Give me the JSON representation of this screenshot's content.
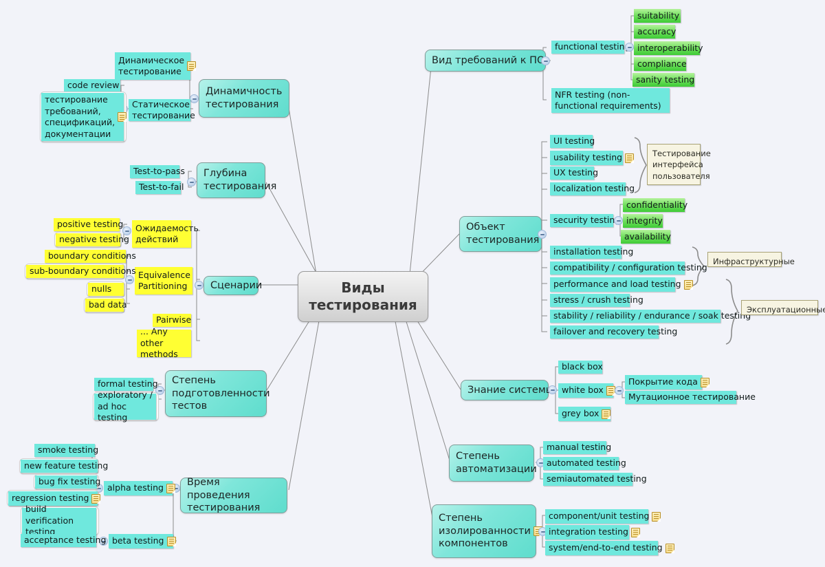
{
  "title": "Виды тестирования",
  "colors": {
    "background": "#f2f3f9",
    "central_fill": "#e4e4e4",
    "branch_teal": "#5fddcd",
    "leaf_teal": "#6fe8dd",
    "leaf_yellow": "#ffff33",
    "leaf_green": "#3fcb36",
    "callout_fill": "#f7f4e2",
    "callout_border": "#a8a275",
    "connector": "#8b8b8b"
  },
  "central": {
    "line1": "Виды",
    "line2": "тестирования"
  },
  "branches": {
    "dynamicity": {
      "label": "Динамичность тестирования"
    },
    "depth": {
      "label": "Глубина тестирования"
    },
    "scenarios": {
      "label": "Сценарии"
    },
    "readiness": {
      "label": "Степень подготовленности тестов"
    },
    "timing": {
      "label": "Время проведения тестирования"
    },
    "requirements": {
      "label": "Вид требований к ПО"
    },
    "object": {
      "label": "Объект тестирования"
    },
    "knowledge": {
      "label": "Знание системы"
    },
    "automation": {
      "label": "Степень автоматизации"
    },
    "isolation": {
      "label": "Степень изолированности компонентов"
    }
  },
  "dynamicity_children": [
    {
      "label": "Динамическое тестирование",
      "note": true
    },
    {
      "label": "Статическое тестирование",
      "note": false
    }
  ],
  "static_children": [
    {
      "label": "code review",
      "note": false
    },
    {
      "label": "тестирование требований, спецификаций, документации",
      "note": true
    }
  ],
  "depth_children": [
    {
      "label": "Test-to-pass"
    },
    {
      "label": "Test-to-fail"
    }
  ],
  "scenarios_children": [
    {
      "label": "Ожидаемость действий"
    },
    {
      "label": "Equivalence Partitioning"
    },
    {
      "label": "Pairwise"
    },
    {
      "label": "... Any other methods"
    }
  ],
  "expectation_children": [
    {
      "label": "positive testing"
    },
    {
      "label": "negative testing"
    }
  ],
  "equivalence_children": [
    {
      "label": "boundary conditions"
    },
    {
      "label": "sub-boundary conditions"
    },
    {
      "label": "nulls"
    },
    {
      "label": "bad data"
    }
  ],
  "readiness_children": [
    {
      "label": "formal testing"
    },
    {
      "label": "exploratory / ad hoc testing"
    }
  ],
  "timing_children": [
    {
      "label": "alpha testing",
      "note": true
    },
    {
      "label": "beta testing",
      "note": true
    }
  ],
  "alpha_children": [
    {
      "label": "smoke testing",
      "note": false
    },
    {
      "label": "new feature testing",
      "note": false
    },
    {
      "label": "bug fix testing",
      "note": false
    },
    {
      "label": "regression testing",
      "note": true
    },
    {
      "label": "build verification testing",
      "note": false
    }
  ],
  "beta_children": [
    {
      "label": "acceptance testing",
      "note": false
    }
  ],
  "requirements_children": [
    {
      "label": "functional testing",
      "note": false
    },
    {
      "label": "NFR testing (non-functional requirements)",
      "note": false
    }
  ],
  "functional_children": [
    {
      "label": "suitability"
    },
    {
      "label": "accuracy"
    },
    {
      "label": "interoperability"
    },
    {
      "label": "compliance"
    },
    {
      "label": "sanity testing"
    }
  ],
  "object_children": [
    {
      "label": "UI testing",
      "note": false
    },
    {
      "label": "usability testing",
      "note": true
    },
    {
      "label": "UX testing",
      "note": false
    },
    {
      "label": "localization testing",
      "note": false
    },
    {
      "label": "security testing",
      "note": false
    },
    {
      "label": "installation testing",
      "note": false
    },
    {
      "label": "compatibility / configuration testing",
      "note": false
    },
    {
      "label": "performance and load testing",
      "note": true
    },
    {
      "label": "stress / crush testing",
      "note": false
    },
    {
      "label": "stability / reliability / endurance / soak testing",
      "note": false
    },
    {
      "label": "failover and recovery testing",
      "note": false
    }
  ],
  "security_children": [
    {
      "label": "confidentiality"
    },
    {
      "label": "integrity"
    },
    {
      "label": "availability"
    }
  ],
  "callouts": {
    "ui": "Тестирование интерфейса пользователя",
    "infra": "Инфраструктурные",
    "operational": "Эксплуатационные"
  },
  "knowledge_children": [
    {
      "label": "black box",
      "note": false
    },
    {
      "label": "white box",
      "note": true
    },
    {
      "label": "grey box",
      "note": true
    }
  ],
  "whitebox_children": [
    {
      "label": "Покрытие кода",
      "note": true
    },
    {
      "label": "Мутационное тестирование",
      "note": false
    }
  ],
  "automation_children": [
    {
      "label": "manual testing"
    },
    {
      "label": "automated testing"
    },
    {
      "label": "semiautomated testing"
    }
  ],
  "isolation_children": [
    {
      "label": "component/unit testing",
      "note": true
    },
    {
      "label": "integration testing",
      "note": true
    },
    {
      "label": "system/end-to-end testing",
      "note": true
    }
  ]
}
